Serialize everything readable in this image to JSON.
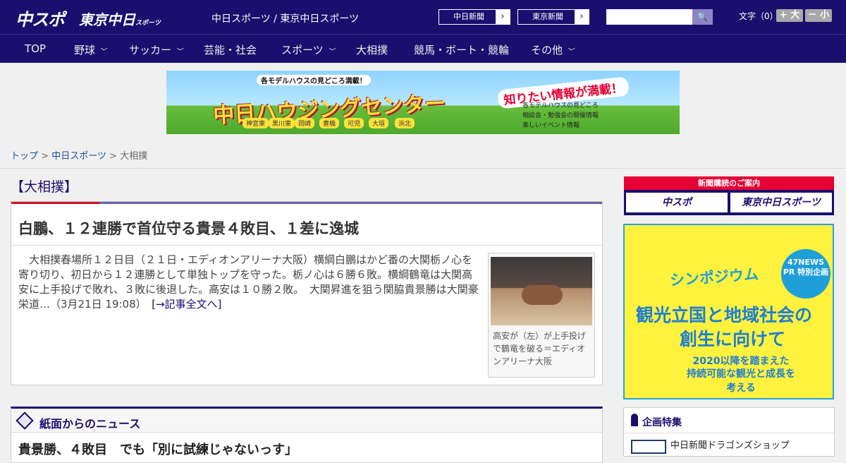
{
  "header": {
    "logo1": "中スポ",
    "logo2": "東京中日",
    "logo2_small": "スポーツ",
    "site_name": "中日スポーツ / 東京中日スポーツ",
    "paper1": "中日新聞",
    "paper2": "東京新聞",
    "search_placeholder": "",
    "fontsize_label": "文字（0）",
    "font_large": "+ 大",
    "font_small": "－ 小"
  },
  "nav": [
    "TOP",
    "野球",
    "サッカー",
    "芸能・社会",
    "スポーツ",
    "大相撲",
    "競馬・ボート・競輪",
    "その他"
  ],
  "banner": {
    "top": "各モデルハウスの見どころ満載！",
    "title": "中日ハウジングセンター",
    "catch": "知りたい情報が満載！",
    "bullets": [
      "各モデルハウスの見どころ",
      "相談会・勉強会の開催情報",
      "楽しいイベント情報"
    ],
    "towns": [
      "神宮東",
      "黒川東",
      "岡崎",
      "豊橋",
      "可児",
      "大垣",
      "浜北"
    ]
  },
  "breadcrumb": {
    "top": "トップ",
    "sep1": " > ",
    "mid": "中日スポーツ",
    "sep2": " > ",
    "current": "大相撲"
  },
  "category": "【大相撲】",
  "article": {
    "headline": "白鵬、１２連勝で首位守る貴景４敗目、１差に逸城",
    "body": "大相撲春場所１２日目（２１日・エディオンアリーナ大阪）横綱白鵬はかど番の大関栃ノ心を寄り切り、初日から１２連勝として単独トップを守った。栃ノ心は６勝６敗。横綱鶴竜は大関高安に上手投げで敗れ、３敗に後退した。高安は１０勝２敗。　大関昇進を狙う関脇貴景勝は大関豪栄道…（3月21日 19:08）　",
    "link": "[→記事全文へ]",
    "caption": "高安が（左）が上手投げで鶴竜を破る＝エディオンアリーナ大阪"
  },
  "news": {
    "title": "紙面からのニュース",
    "first": "貴景勝、４敗目　でも「別に試練じゃないっす」"
  },
  "sidebar": {
    "sub_header": "新聞購読のご案内",
    "sub_btn1": "中スポ",
    "sub_btn2": "東京中日スポーツ",
    "ad_badge": "47NEWS PR 特別企画",
    "ad_sym": "シンポジウム",
    "ad_l1": "観光立国と地域社会の",
    "ad_l2": "創生に向けて",
    "ad_s1": "2020以降を踏まえた",
    "ad_s2": "持続可能な観光と成長を",
    "ad_s3": "考える",
    "feat_title": "企画特集",
    "feat_item": "中日新聞ドラゴンズショップ"
  }
}
